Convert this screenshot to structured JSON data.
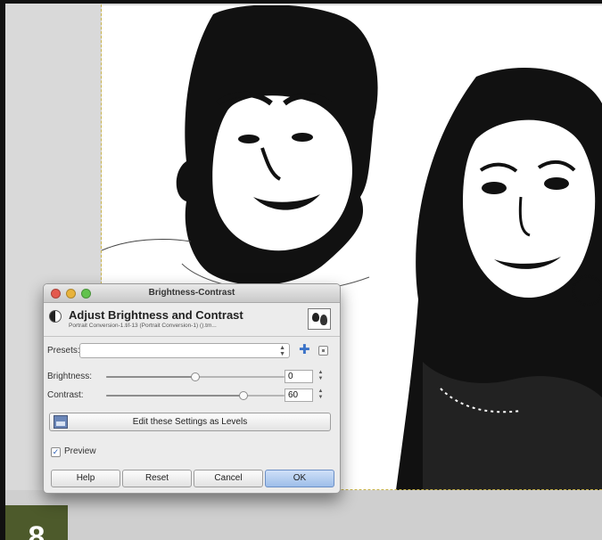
{
  "step_badge": "8",
  "dialog": {
    "window_title": "Brightness-Contrast",
    "header_title": "Adjust Brightness and Contrast",
    "header_subtitle": "Portrait Conversion-1.tif-13 (Portrait Conversion-1) ().tm...",
    "presets": {
      "label": "Presets:",
      "value": ""
    },
    "brightness": {
      "label": "Brightness:",
      "value": "0",
      "slider_fraction": 0.5
    },
    "contrast": {
      "label": "Contrast:",
      "value": "60",
      "slider_fraction": 0.77
    },
    "levels_button_label": "Edit these Settings as Levels",
    "preview": {
      "label": "Preview",
      "checked": true
    },
    "buttons": {
      "help": "Help",
      "reset": "Reset",
      "cancel": "Cancel",
      "ok": "OK"
    }
  },
  "colors": {
    "ok_button": "#9dbde9",
    "step_badge_bg": "#4d5a2b",
    "selection_border": "#c7b24a"
  },
  "icons": [
    "arrow-up-down-icon",
    "add-icon",
    "menu-icon",
    "levels-icon",
    "checkmark-icon",
    "brightness-contrast-icon"
  ]
}
